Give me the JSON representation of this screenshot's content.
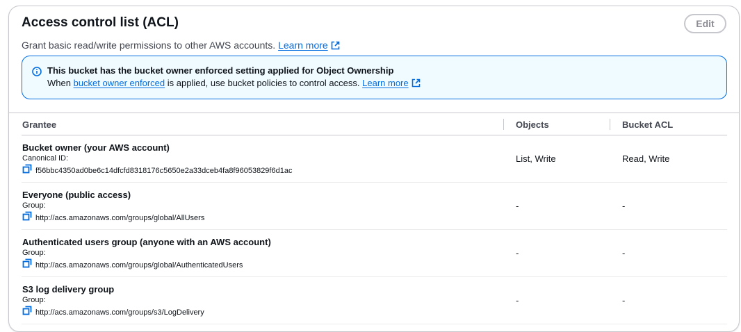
{
  "panel": {
    "title": "Access control list (ACL)",
    "description": "Grant basic read/write permissions to other AWS accounts.",
    "learn_more": "Learn more",
    "edit_label": "Edit"
  },
  "alert": {
    "title": "This bucket has the bucket owner enforced setting applied for Object Ownership",
    "text_prefix": "When",
    "text_link": "bucket owner enforced",
    "text_suffix": "is applied, use bucket policies to control access.",
    "learn_more": "Learn more"
  },
  "table": {
    "headers": {
      "grantee": "Grantee",
      "objects": "Objects",
      "bucket_acl": "Bucket ACL"
    },
    "rows": [
      {
        "name": "Bucket owner (your AWS account)",
        "id_label": "Canonical ID:",
        "id_value": "f56bbc4350ad0be6c14dfcfd8318176c5650e2a33dceb4fa8f96053829f6d1ac",
        "objects": "List, Write",
        "bucket_acl": "Read, Write"
      },
      {
        "name": "Everyone (public access)",
        "id_label": "Group:",
        "id_value": "http://acs.amazonaws.com/groups/global/AllUsers",
        "objects": "-",
        "bucket_acl": "-"
      },
      {
        "name": "Authenticated users group (anyone with an AWS account)",
        "id_label": "Group:",
        "id_value": "http://acs.amazonaws.com/groups/global/AuthenticatedUsers",
        "objects": "-",
        "bucket_acl": "-"
      },
      {
        "name": "S3 log delivery group",
        "id_label": "Group:",
        "id_value": "http://acs.amazonaws.com/groups/s3/LogDelivery",
        "objects": "-",
        "bucket_acl": "-"
      }
    ]
  },
  "colors": {
    "link": "#006ce0",
    "alert_border": "#006ce0",
    "alert_bg": "#f0fbff",
    "border": "#c6c6cd"
  },
  "icons": [
    "external-link-icon",
    "info-icon",
    "copy-icon"
  ]
}
